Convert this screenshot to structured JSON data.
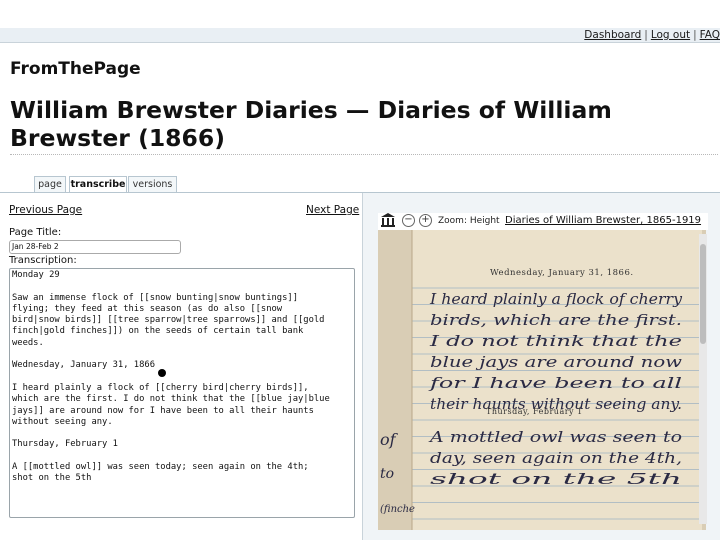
{
  "top_nav": {
    "dashboard": "Dashboard",
    "logout": "Log out",
    "faq": "FAQ",
    "separator": "|"
  },
  "site": {
    "name": "FromThePage"
  },
  "page": {
    "title": "William Brewster Diaries — Diaries of William Brewster (1866)"
  },
  "tabs": [
    {
      "label": "page"
    },
    {
      "label": "transcribe"
    },
    {
      "label": "versions"
    }
  ],
  "pager": {
    "previous": "Previous Page",
    "next": "Next Page"
  },
  "form": {
    "page_title_label": "Page Title:",
    "page_title_value": "Jan 28-Feb 2",
    "transcription_label": "Transcription:",
    "transcription_text": "Monday 29\n\nSaw an immense flock of [[snow bunting|snow buntings]]\nflying; they feed at this season (as do also [[snow\nbird|snow birds]] [[tree sparrow|tree sparrows]] and [[gold\nfinch|gold finches]]) on the seeds of certain tall bank\nweeds.\n\nWednesday, January 31, 1866\n\nI heard plainly a flock of [[cherry bird|cherry birds]],\nwhich are the first. I do not think that the [[blue jay|blue\njays]] are around now for I have been to all their haunts\nwithout seeing any.\n\nThursday, February 1\n\nA [[mottled owl]] was seen today; seen again on the 4th;\nshot on the 5th"
  },
  "viewer": {
    "zoom_label": "Zoom: Height",
    "collection_link": "Diaries of William Brewster, 1865-1919",
    "icons": [
      "library-icon",
      "zoom-out-icon",
      "zoom-in-icon"
    ],
    "image_text": {
      "heading1": "Wednesday, January 31, 1866.",
      "lines1": [
        "I heard plainly a flock of cherry",
        "birds, which are the first.",
        "I do not think that the",
        "blue jays are around now",
        "for I have been to all",
        "their haunts without seeing any."
      ],
      "heading2": "Thursday, February 1",
      "lines2": [
        "A mottled owl was seen to",
        "day, seen again on the 4th,",
        "shot on the 5th"
      ]
    }
  }
}
